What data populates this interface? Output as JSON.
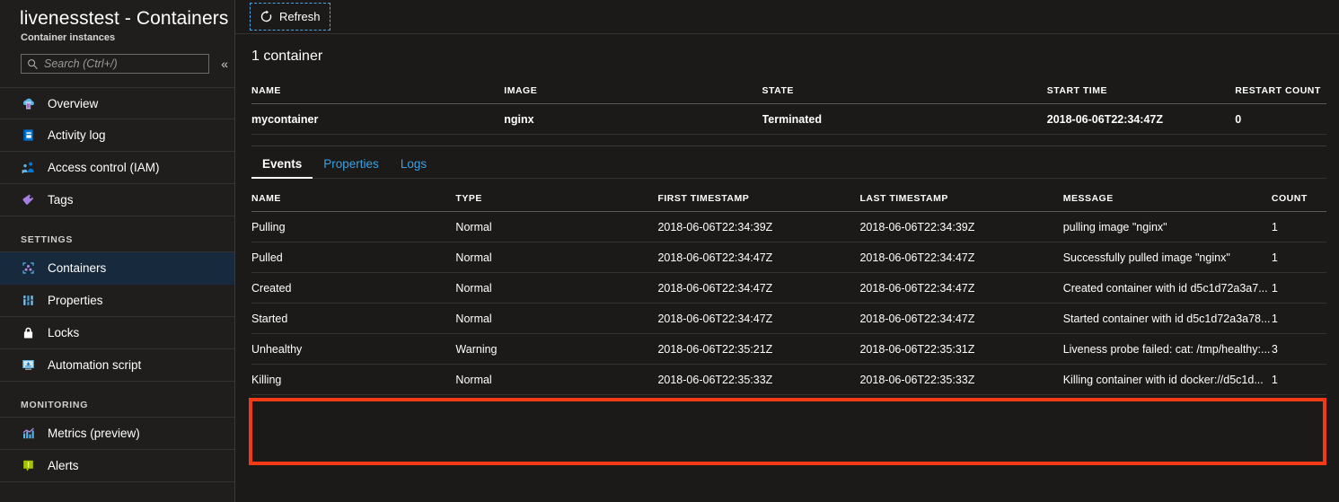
{
  "blade": {
    "title": "livenesstest - Containers",
    "subtitle": "Container instances"
  },
  "search": {
    "placeholder": "Search (Ctrl+/)",
    "icon": "search-icon",
    "collapse_icon": "chevron-double-left-icon",
    "collapse_glyph": "«"
  },
  "sidebar": {
    "items": [
      {
        "label": "Overview",
        "icon": "overview-icon",
        "selected": false
      },
      {
        "label": "Activity log",
        "icon": "activity-log-icon",
        "selected": false
      },
      {
        "label": "Access control (IAM)",
        "icon": "access-control-icon",
        "selected": false
      },
      {
        "label": "Tags",
        "icon": "tags-icon",
        "selected": false
      }
    ],
    "groups": [
      {
        "label": "SETTINGS",
        "items": [
          {
            "label": "Containers",
            "icon": "containers-icon",
            "selected": true
          },
          {
            "label": "Properties",
            "icon": "properties-icon",
            "selected": false
          },
          {
            "label": "Locks",
            "icon": "lock-icon",
            "selected": false
          },
          {
            "label": "Automation script",
            "icon": "automation-script-icon",
            "selected": false
          }
        ]
      },
      {
        "label": "MONITORING",
        "items": [
          {
            "label": "Metrics (preview)",
            "icon": "metrics-icon",
            "selected": false
          },
          {
            "label": "Alerts",
            "icon": "alerts-icon",
            "selected": false
          }
        ]
      }
    ]
  },
  "toolbar": {
    "refresh_label": "Refresh",
    "refresh_icon": "refresh-icon"
  },
  "containers": {
    "count_label": "1 container",
    "columns": [
      "NAME",
      "IMAGE",
      "STATE",
      "START TIME",
      "RESTART COUNT"
    ],
    "rows": [
      {
        "name": "mycontainer",
        "image": "nginx",
        "state": "Terminated",
        "start_time": "2018-06-06T22:34:47Z",
        "restart_count": "0"
      }
    ]
  },
  "tabs": [
    {
      "label": "Events",
      "active": true
    },
    {
      "label": "Properties",
      "active": false
    },
    {
      "label": "Logs",
      "active": false
    }
  ],
  "events": {
    "columns": [
      "NAME",
      "TYPE",
      "FIRST TIMESTAMP",
      "LAST TIMESTAMP",
      "MESSAGE",
      "COUNT"
    ],
    "rows": [
      {
        "name": "Pulling",
        "type": "Normal",
        "first_timestamp": "2018-06-06T22:34:39Z",
        "last_timestamp": "2018-06-06T22:34:39Z",
        "message": "pulling image \"nginx\"",
        "count": "1",
        "highlighted": false
      },
      {
        "name": "Pulled",
        "type": "Normal",
        "first_timestamp": "2018-06-06T22:34:47Z",
        "last_timestamp": "2018-06-06T22:34:47Z",
        "message": "Successfully pulled image \"nginx\"",
        "count": "1",
        "highlighted": false
      },
      {
        "name": "Created",
        "type": "Normal",
        "first_timestamp": "2018-06-06T22:34:47Z",
        "last_timestamp": "2018-06-06T22:34:47Z",
        "message": "Created container with id d5c1d72a3a7...",
        "count": "1",
        "highlighted": false
      },
      {
        "name": "Started",
        "type": "Normal",
        "first_timestamp": "2018-06-06T22:34:47Z",
        "last_timestamp": "2018-06-06T22:34:47Z",
        "message": "Started container with id d5c1d72a3a78...",
        "count": "1",
        "highlighted": false
      },
      {
        "name": "Unhealthy",
        "type": "Warning",
        "first_timestamp": "2018-06-06T22:35:21Z",
        "last_timestamp": "2018-06-06T22:35:31Z",
        "message": "Liveness probe failed: cat: /tmp/healthy:...",
        "count": "3",
        "highlighted": true
      },
      {
        "name": "Killing",
        "type": "Normal",
        "first_timestamp": "2018-06-06T22:35:33Z",
        "last_timestamp": "2018-06-06T22:35:33Z",
        "message": "Killing container with id docker://d5c1d...",
        "count": "1",
        "highlighted": true
      }
    ]
  },
  "colors": {
    "background": "#1b1a19",
    "sidebar_background": "#1f1e1d",
    "selected_item": "#17293d",
    "link": "#3aa0e3",
    "focus_outline": "#4aa8e8",
    "highlight_box": "#f23b16"
  }
}
